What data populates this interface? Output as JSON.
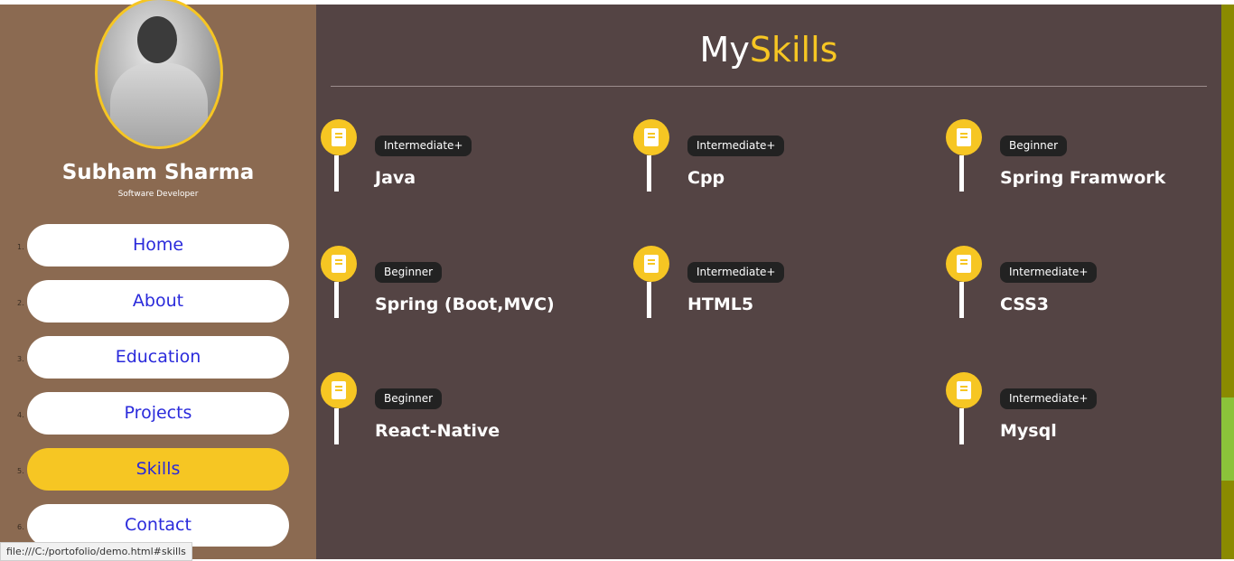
{
  "sidebar": {
    "profile": {
      "name": "Subham Sharma",
      "role": "Software Developer"
    },
    "nav": [
      {
        "num": "1.",
        "label": "Home"
      },
      {
        "num": "2.",
        "label": "About"
      },
      {
        "num": "3.",
        "label": "Education"
      },
      {
        "num": "4.",
        "label": "Projects"
      },
      {
        "num": "5.",
        "label": "Skills",
        "active": true
      },
      {
        "num": "6.",
        "label": "Contact"
      }
    ]
  },
  "main": {
    "title_part1": "My",
    "title_part2": "Skills",
    "skills": [
      {
        "level": "Intermediate+",
        "name": "Java"
      },
      {
        "level": "Intermediate+",
        "name": "Cpp"
      },
      {
        "level": "Beginner",
        "name": "Spring Framwork"
      },
      {
        "level": "Beginner",
        "name": "Spring (Boot,MVC)"
      },
      {
        "level": "Intermediate+",
        "name": "HTML5"
      },
      {
        "level": "Intermediate+",
        "name": "CSS3"
      },
      {
        "level": "Beginner",
        "name": "React-Native"
      },
      {
        "level": "Intermediate+",
        "name": "Mysql"
      }
    ]
  },
  "status_bar": {
    "url": "file:///C:/portofolio/demo.html#skills"
  },
  "colors": {
    "sidebar_bg": "#8b6a51",
    "main_bg": "#544444",
    "accent": "#f6c623",
    "nav_text": "#2a2adb",
    "badge_bg": "#222222"
  },
  "icons": {
    "skill_icon": "book-icon",
    "avatar": "profile-photo"
  }
}
